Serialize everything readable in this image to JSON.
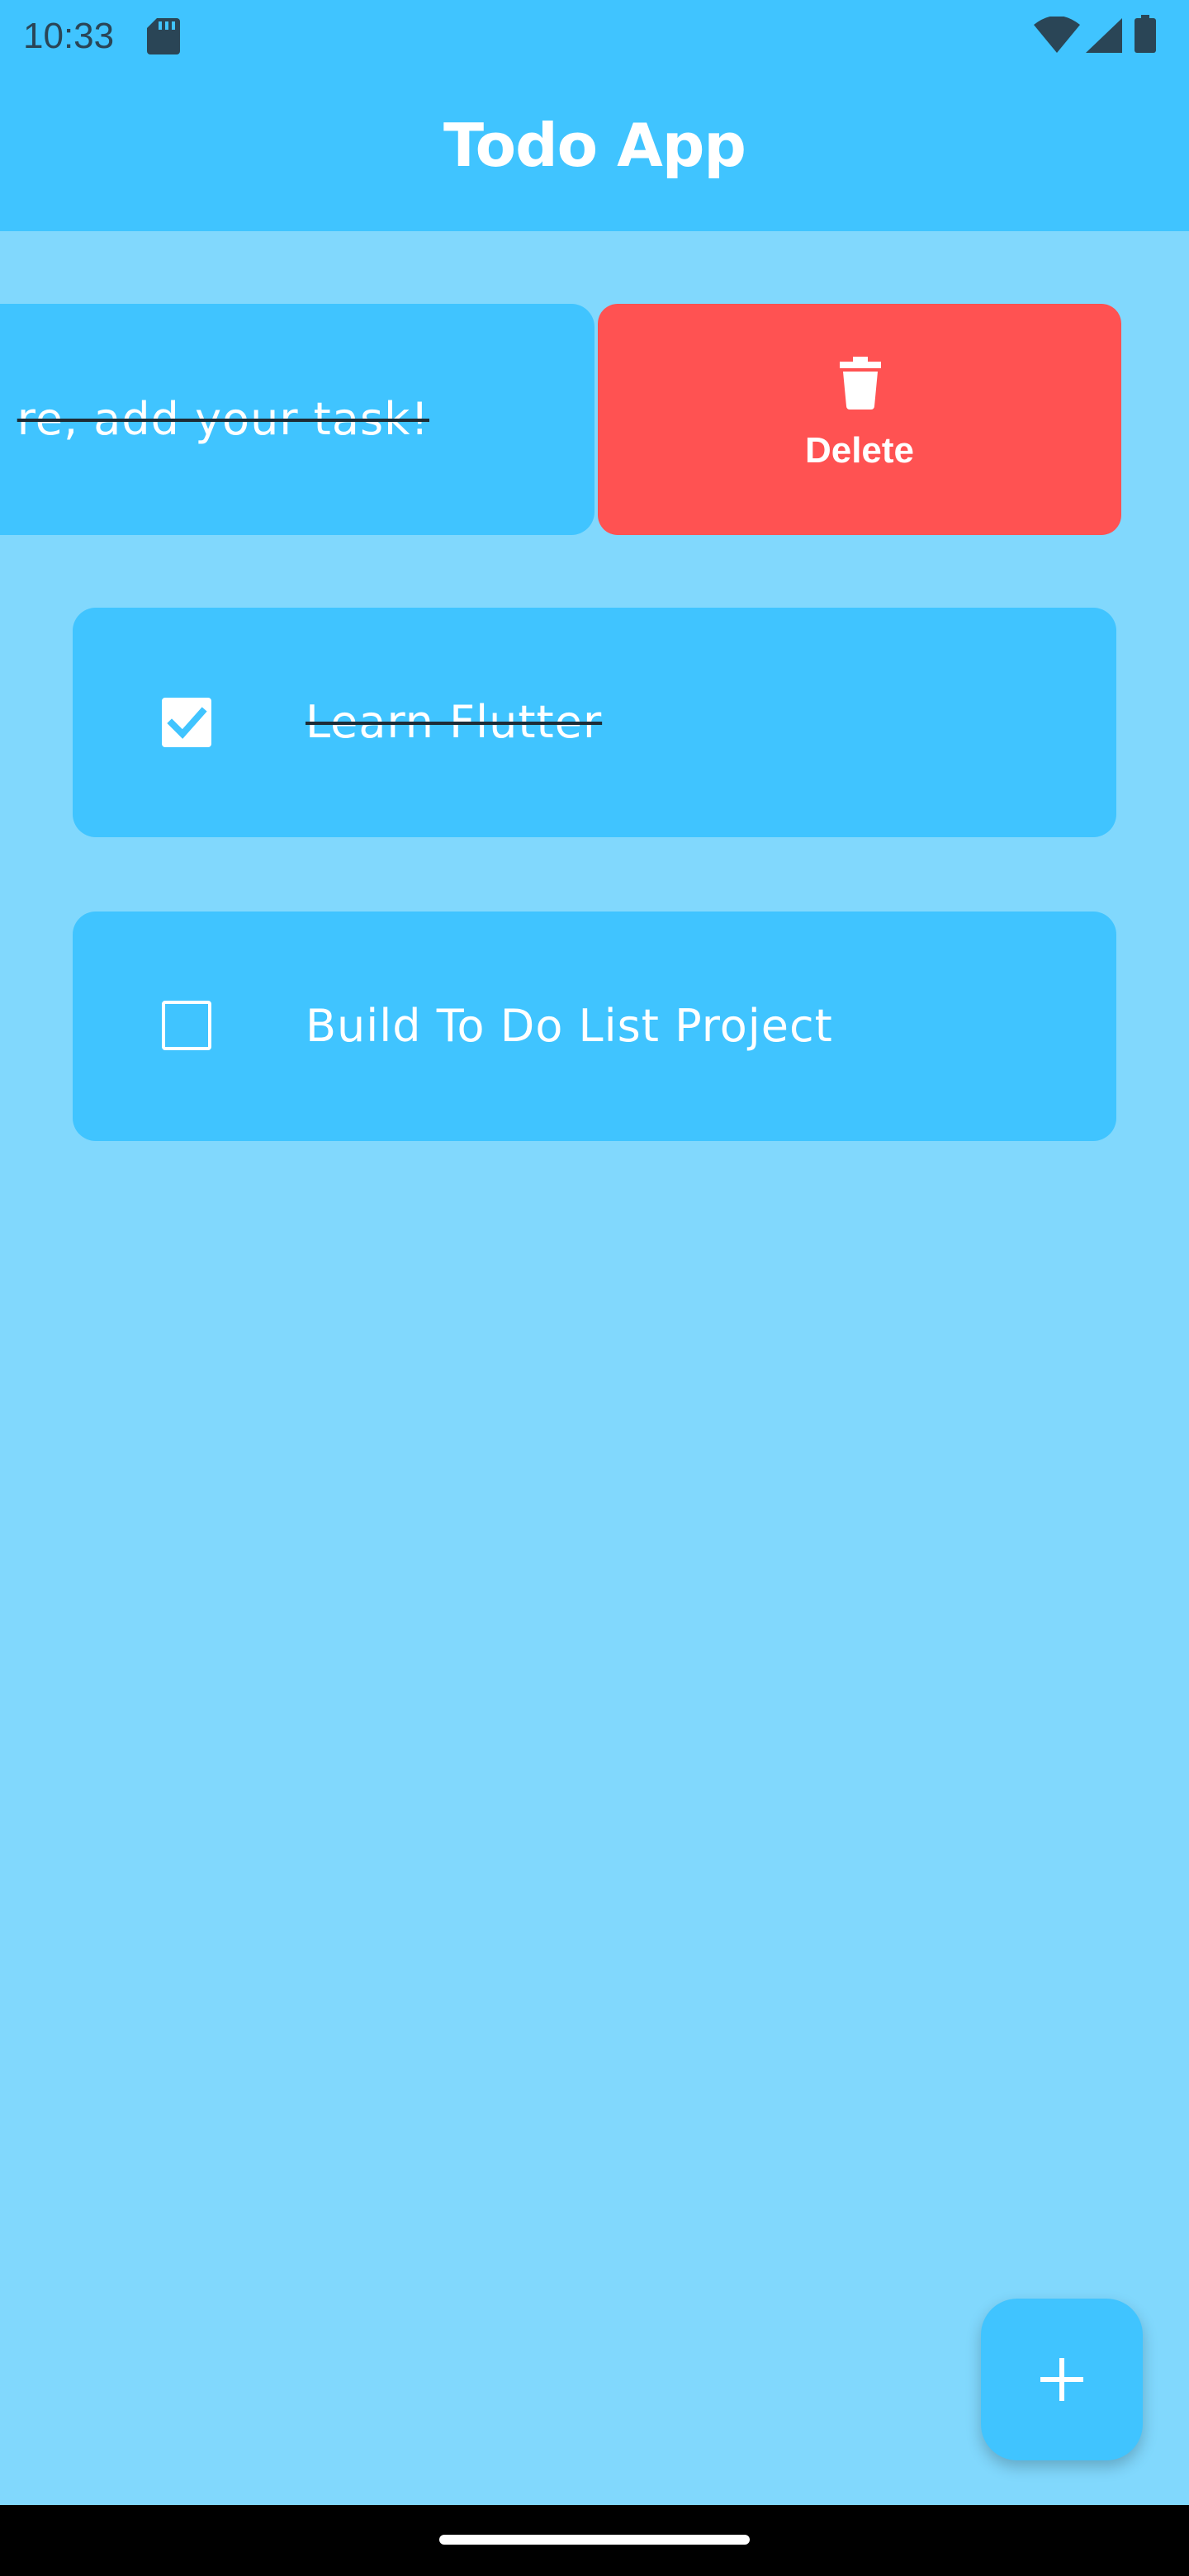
{
  "status_bar": {
    "time": "10:33",
    "icons": [
      "sd-card-icon",
      "wifi-icon",
      "signal-icon",
      "battery-icon"
    ]
  },
  "app_bar": {
    "title": "Todo App"
  },
  "todos": [
    {
      "text": "re, add your task!",
      "done": true,
      "swiped": true
    },
    {
      "text": "Learn Flutter",
      "done": true,
      "swiped": false
    },
    {
      "text": "Build To Do List Project",
      "done": false,
      "swiped": false
    }
  ],
  "delete_action": {
    "label": "Delete",
    "icon": "trash-icon"
  },
  "fab": {
    "icon": "plus-icon"
  },
  "colors": {
    "primary": "#40C4FF",
    "background": "#81D8FD",
    "delete": "#FF5252",
    "text": "#FFFFFF"
  }
}
